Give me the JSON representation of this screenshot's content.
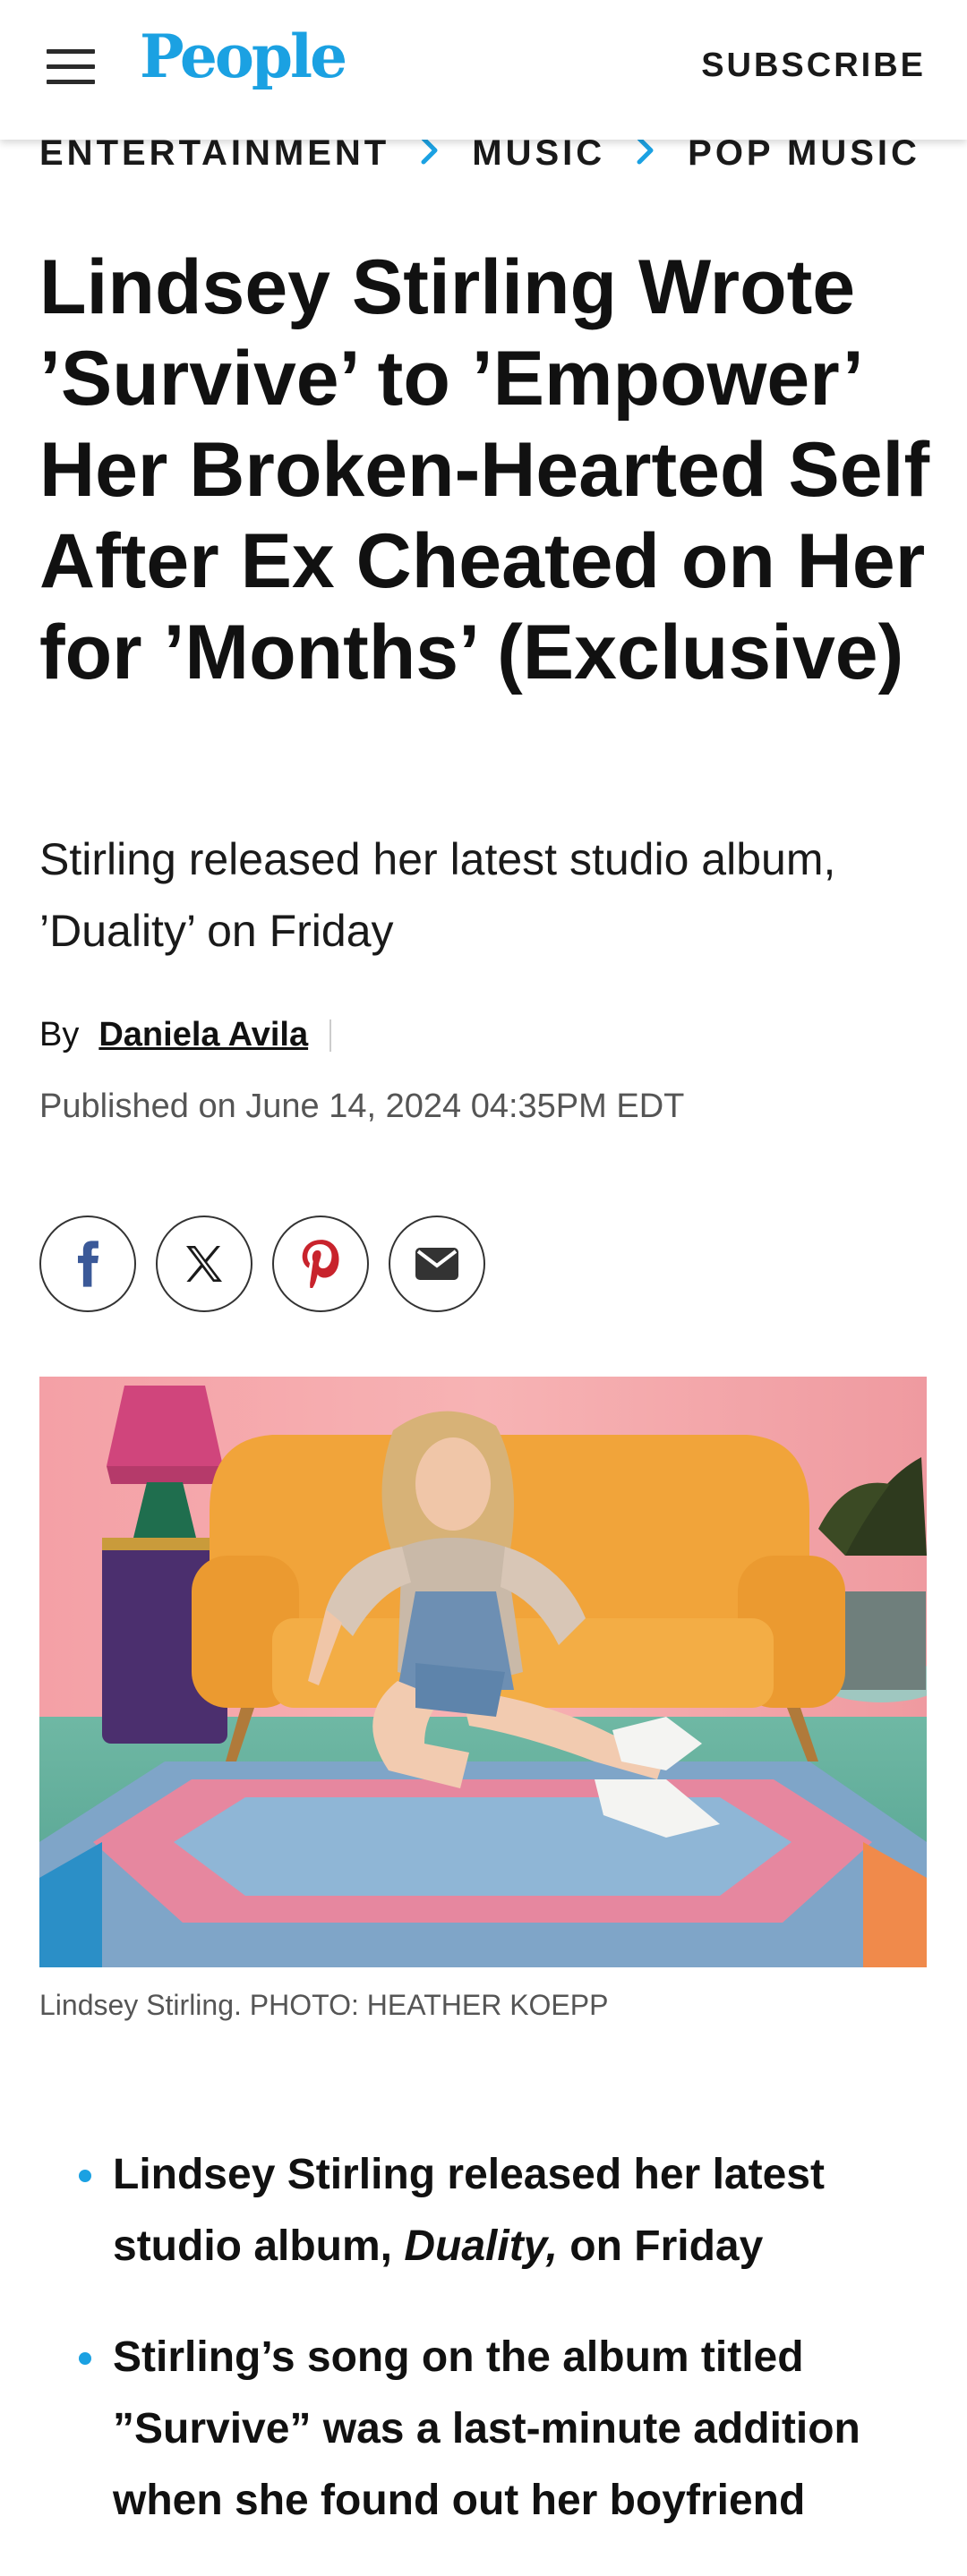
{
  "header": {
    "logo": "People",
    "subscribe_label": "SUBSCRIBE"
  },
  "breadcrumb": [
    "ENTERTAINMENT",
    "MUSIC",
    "POP MUSIC"
  ],
  "article": {
    "title": "Lindsey Stirling Wrote ’Survive’ to ’Empower’ Her Broken-Hearted Self After Ex Cheated on Her for ’Months’ (Exclusive)",
    "dek": "Stirling released her latest studio album, ’Duality’ on Friday",
    "by_label": "By",
    "author": "Daniela Avila",
    "published": "Published on June 14, 2024 04:35PM EDT",
    "image_caption": "Lindsey Stirling. PHOTO: HEATHER KOEPP",
    "bullets": [
      {
        "before": "Lindsey Stirling released her latest studio album, ",
        "em": "Duality,",
        "after": " on Friday"
      },
      {
        "before": "Stirling’s song on the album titled ”Survive” was a last-minute addition when she found out her boyfriend",
        "em": "",
        "after": ""
      }
    ]
  },
  "social": [
    {
      "icon": "facebook-icon"
    },
    {
      "icon": "x-icon"
    },
    {
      "icon": "pinterest-icon"
    },
    {
      "icon": "email-icon"
    }
  ],
  "colors": {
    "brand": "#1ba1e2",
    "pinterest": "#c8232c",
    "facebook": "#3b5998"
  }
}
